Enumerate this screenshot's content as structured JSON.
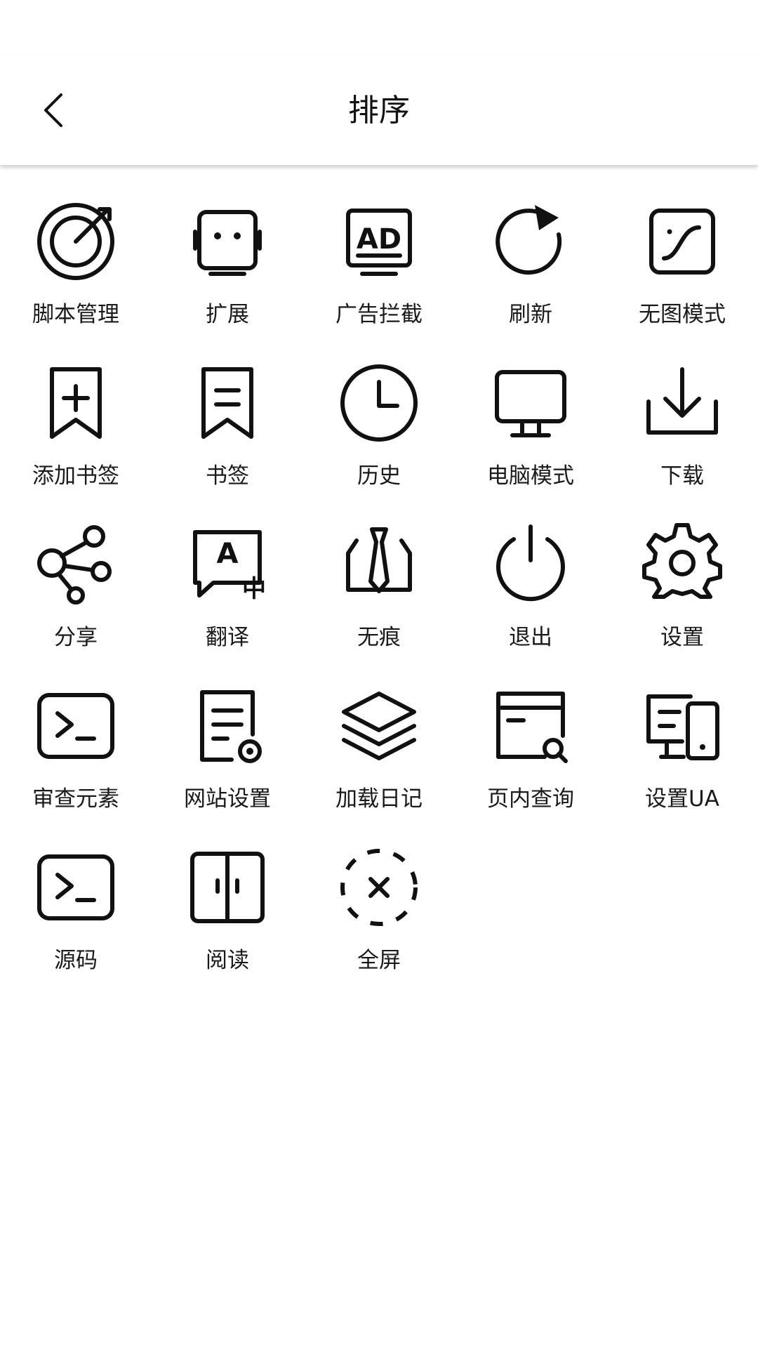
{
  "header": {
    "title": "排序",
    "back_icon": "chevron-left-icon"
  },
  "items": [
    {
      "label": "脚本管理",
      "icon": "script-icon"
    },
    {
      "label": "扩展",
      "icon": "extension-icon"
    },
    {
      "label": "广告拦截",
      "icon": "ad-block-icon"
    },
    {
      "label": "刷新",
      "icon": "refresh-icon"
    },
    {
      "label": "无图模式",
      "icon": "no-image-icon"
    },
    {
      "label": "添加书签",
      "icon": "add-bookmark-icon"
    },
    {
      "label": "书签",
      "icon": "bookmark-icon"
    },
    {
      "label": "历史",
      "icon": "history-icon"
    },
    {
      "label": "电脑模式",
      "icon": "desktop-icon"
    },
    {
      "label": "下载",
      "icon": "download-icon"
    },
    {
      "label": "分享",
      "icon": "share-icon"
    },
    {
      "label": "翻译",
      "icon": "translate-icon"
    },
    {
      "label": "无痕",
      "icon": "incognito-icon"
    },
    {
      "label": "退出",
      "icon": "power-icon"
    },
    {
      "label": "设置",
      "icon": "gear-icon"
    },
    {
      "label": "审查元素",
      "icon": "terminal-icon"
    },
    {
      "label": "网站设置",
      "icon": "site-settings-icon"
    },
    {
      "label": "加载日记",
      "icon": "layers-icon"
    },
    {
      "label": "页内查询",
      "icon": "find-in-page-icon"
    },
    {
      "label": "设置UA",
      "icon": "devices-icon"
    },
    {
      "label": "源码",
      "icon": "source-code-icon"
    },
    {
      "label": "阅读",
      "icon": "reader-icon"
    },
    {
      "label": "全屏",
      "icon": "fullscreen-icon"
    }
  ]
}
